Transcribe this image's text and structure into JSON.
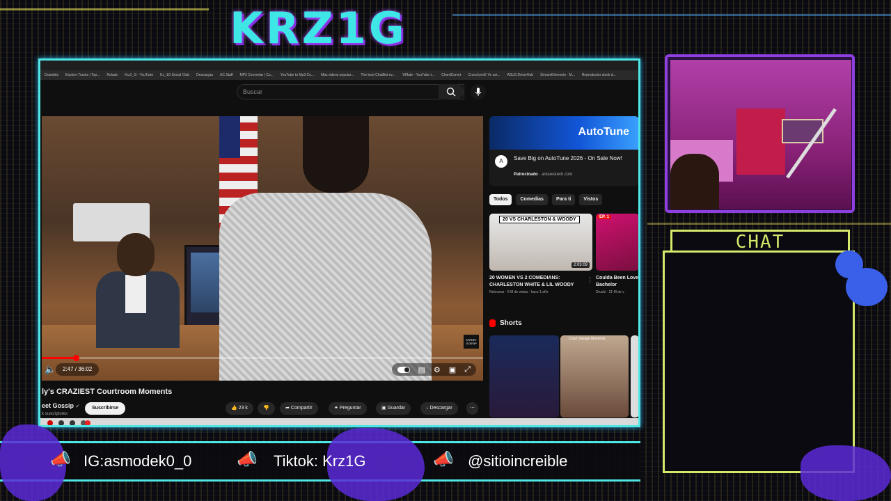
{
  "stream": {
    "logo": "KRZ1G",
    "chat_title": "CHAT",
    "socials": [
      {
        "label": "IG:asmodek0_0"
      },
      {
        "label": "Tiktok: Krz1G"
      },
      {
        "label": "@sitioincreible"
      }
    ]
  },
  "browser": {
    "bookmarks": [
      "Drambits",
      "Explore Tracks | Top...",
      "Roludo",
      "Krz1_G - YouTube",
      "Kz_1G Social Club",
      "Descargas",
      "AC Staff",
      "MP3 Convertar | Cu...",
      "YouTube to Mp3 Co...",
      "Mas videos popular...",
      "The best ChatBot ev...",
      "YiMate - YouTube t...",
      "ChordConvrt",
      "Crunchyroll: Ve ani...",
      "ASUS DriverHub",
      "StreamElements - M...",
      "Reproductor stock d..."
    ]
  },
  "youtube": {
    "search_placeholder": "Buscar",
    "player": {
      "time": "2:47 / 36:02",
      "progress": 0.077,
      "badge": "STREET GOSSIP"
    },
    "video": {
      "title": "ly's CRAZIEST Courtroom Moments",
      "channel": "eet Gossip",
      "verified": "✓",
      "subscribers": "k suscriptores",
      "subscribe_label": "Suscribirse",
      "likes": "23 k",
      "share_label": "Compartir",
      "ask_label": "Preguntar",
      "save_label": "Guardar",
      "download_label": "Descargar"
    },
    "ad": {
      "brand": "AutoTune",
      "title": "Save Big on AutoTune 2026 - On Sale Now!",
      "sponsored": "Patrocinado",
      "domain": "antarestech.com"
    },
    "chips": [
      "Todos",
      "Comedias",
      "Para ti",
      "Vistos"
    ],
    "recommendations": [
      {
        "thumb_label": "20 VS CHARLESTON & WOODY",
        "duration": "2:03:09",
        "title": "20 WOMEN VS 2 COMEDIANS: CHARLESTON WHITE & LIL WOODY",
        "channel": "Nolovmar",
        "meta": "6 M de vistas · hace 1 año"
      },
      {
        "thumb_label": "EP. 1",
        "title": "Coulda Been Love Bachelor",
        "channel": "Druski",
        "meta": "21 M de v"
      }
    ],
    "shorts_label": "Shorts",
    "short_label": "Court Savage Moments"
  },
  "icons": [
    "search-icon",
    "mic-icon",
    "volume-icon",
    "settings-icon",
    "fullscreen-icon",
    "megaphone-icon",
    "like-icon",
    "dislike-icon",
    "share-icon",
    "ask-icon",
    "save-icon",
    "download-icon",
    "more-icon"
  ]
}
